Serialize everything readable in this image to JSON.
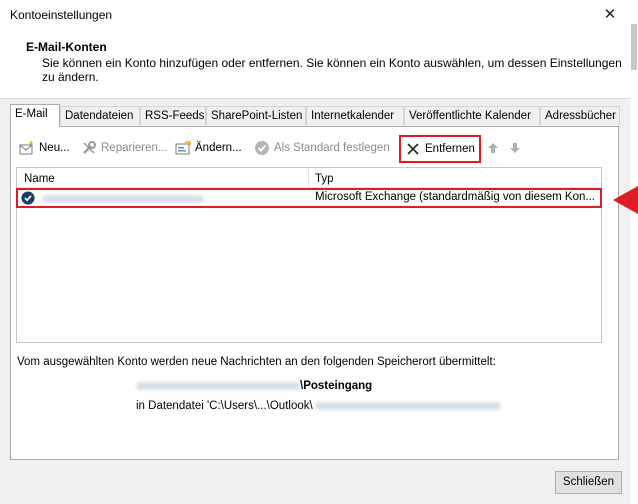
{
  "window": {
    "title": "Kontoeinstellungen"
  },
  "header": {
    "title": "E-Mail-Konten",
    "description": "Sie können ein Konto hinzufügen oder entfernen. Sie können ein Konto auswählen, um dessen Einstellungen zu ändern."
  },
  "tabs": [
    {
      "label": "E-Mail"
    },
    {
      "label": "Datendateien"
    },
    {
      "label": "RSS-Feeds"
    },
    {
      "label": "SharePoint-Listen"
    },
    {
      "label": "Internetkalender"
    },
    {
      "label": "Veröffentlichte Kalender"
    },
    {
      "label": "Adressbücher"
    }
  ],
  "toolbar": {
    "new_label": "Neu...",
    "repair_label": "Reparieren...",
    "change_label": "Ändern...",
    "default_label": "Als Standard festlegen",
    "remove_label": "Entfernen"
  },
  "list": {
    "col_name": "Name",
    "col_type": "Typ",
    "rows": [
      {
        "type": "Microsoft Exchange (standardmäßig von diesem Kon..."
      }
    ]
  },
  "info": {
    "text": "Vom ausgewählten Konto werden neue Nachrichten an den folgenden Speicherort übermittelt:",
    "folder_suffix": "\\Posteingang",
    "datafile_prefix": "in Datendatei 'C:\\Users\\...\\Outlook\\"
  },
  "footer": {
    "close_label": "Schließen"
  },
  "colors": {
    "highlight": "#e11b22",
    "accent": "#1a3d6d"
  }
}
